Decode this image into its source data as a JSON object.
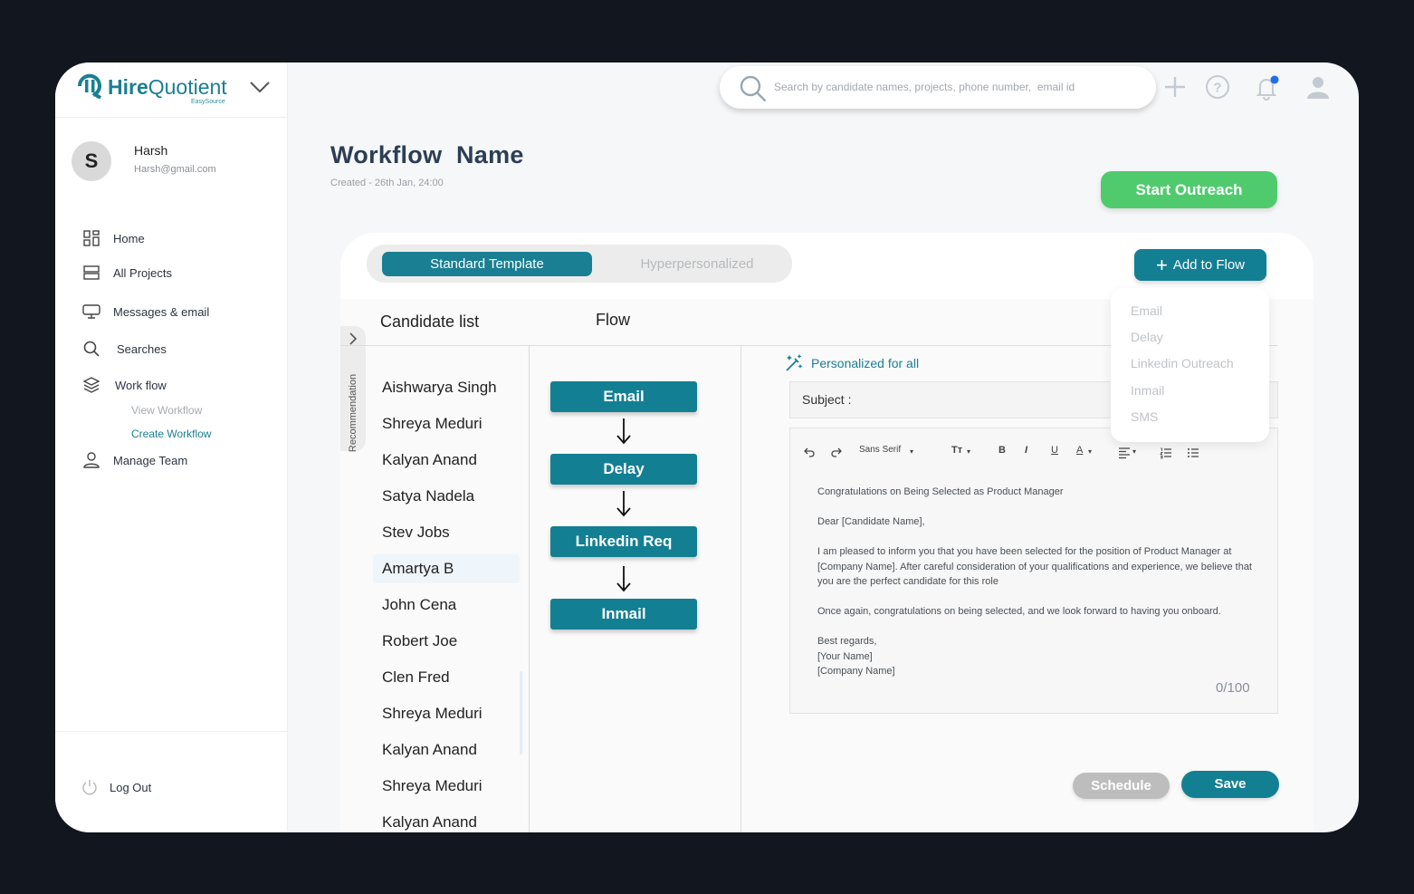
{
  "brand": {
    "name_bold": "Hire",
    "name_light": "Quotient",
    "subtitle": "EasySource",
    "accent": "#1a7f92"
  },
  "user": {
    "initial": "S",
    "name": "Harsh",
    "email": "Harsh@gmail.com"
  },
  "sidebar": {
    "items": [
      {
        "label": "Home",
        "icon": "grid-icon"
      },
      {
        "label": "All Projects",
        "icon": "projects-icon"
      },
      {
        "label": "Messages & email",
        "icon": "message-icon"
      },
      {
        "label": "Searches",
        "icon": "search-icon"
      },
      {
        "label": "Work flow",
        "icon": "layers-icon"
      },
      {
        "label": "Manage Team",
        "icon": "user-icon"
      }
    ],
    "subitems": [
      {
        "label": "View Workflow"
      },
      {
        "label": "Create Workflow"
      }
    ],
    "logout": "Log Out"
  },
  "search": {
    "placeholder": "Search by candidate names, projects, phone number,  email id"
  },
  "header": {
    "title": "Workflow  Name",
    "created": "Created - 26th Jan, 24:00",
    "start_button": "Start Outreach"
  },
  "tabs": {
    "active": "Standard Template",
    "inactive": "Hyperpersonalized"
  },
  "add_flow": {
    "label": "Add to Flow",
    "options": [
      "Email",
      "Delay",
      "Linkedin Outreach",
      "Inmail",
      "SMS"
    ]
  },
  "recommendation": "Recommendation",
  "columns": {
    "candidates": "Candidate list",
    "flow": "Flow"
  },
  "candidates": [
    "Aishwarya Singh",
    "Shreya Meduri",
    "Kalyan Anand",
    "Satya Nadela",
    "Stev Jobs",
    "Amartya B",
    "John Cena",
    "Robert Joe",
    "Clen Fred",
    "Shreya Meduri",
    "Kalyan Anand",
    "Shreya Meduri",
    "Kalyan Anand"
  ],
  "selected_candidate": "Amartya B",
  "flow_steps": [
    "Email",
    "Delay",
    "Linkedin Req",
    "Inmail"
  ],
  "editor": {
    "personalized": "Personalized for all",
    "subject_label": "Subject :",
    "toolbar_font": "Sans Serif",
    "toolbar_size": "Tт",
    "toolbar_bold": "B",
    "toolbar_italic": "I",
    "toolbar_underline": "U",
    "toolbar_color": "A",
    "body": {
      "line1": "Congratulations on Being Selected as Product Manager",
      "line2": "Dear [Candidate Name],",
      "line3": "I am pleased to inform you that you have been selected for the position of Product Manager at [Company Name]. After careful consideration of your qualifications and experience, we believe that you are the perfect candidate for this role",
      "line4": "Once again, congratulations on being selected, and we look forward to having you onboard.",
      "sig1": "Best regards,",
      "sig2": "[Your Name]",
      "sig3": "[Company Name]"
    },
    "counter": "0/100"
  },
  "actions": {
    "schedule": "Schedule",
    "save": "Save"
  }
}
